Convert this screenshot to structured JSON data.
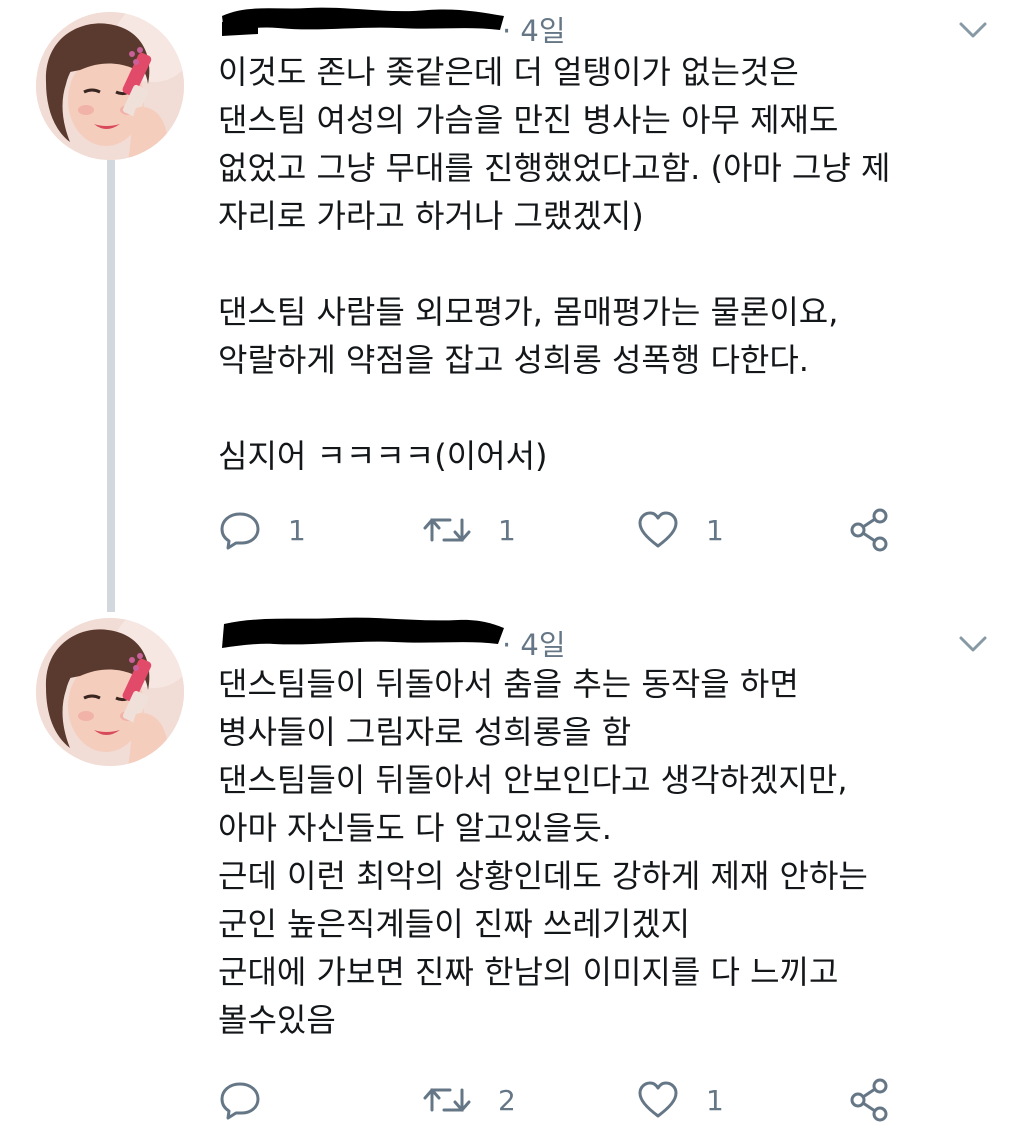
{
  "colors": {
    "text": "#14171a",
    "muted": "#657786",
    "thread_line": "#d2d8de",
    "redaction": "#000000"
  },
  "tweets": [
    {
      "time": "· 4일",
      "body": "이것도 존나 좆같은데 더 얼탱이가 없는것은\n댄스팀 여성의 가슴을 만진 병사는 아무 제재도\n없었고 그냥 무대를 진행했었다고함. (아마 그냥 제\n자리로 가라고 하거나 그랬겠지)\n\n댄스팀 사람들 외모평가, 몸매평가는 물론이요,\n악랄하게 약점을 잡고 성희롱 성폭행 다한다.\n\n심지어 ㅋㅋㅋㅋ(이어서)",
      "reply_count": "1",
      "retweet_count": "1",
      "like_count": "1"
    },
    {
      "time": "· 4일",
      "body": "댄스팀들이 뒤돌아서 춤을 추는 동작을 하면\n병사들이 그림자로 성희롱을 함\n댄스팀들이 뒤돌아서 안보인다고 생각하겠지만,\n아마 자신들도 다 알고있을듯.\n근데 이런 최악의 상황인데도 강하게 제재 안하는\n군인 높은직계들이 진짜 쓰레기겠지\n군대에 가보면 진짜 한남의 이미지를 다 느끼고\n볼수있음",
      "reply_count": "",
      "retweet_count": "2",
      "like_count": "1"
    }
  ],
  "icons": {
    "reply": "reply-icon",
    "retweet": "retweet-icon",
    "like": "heart-icon",
    "share": "share-icon",
    "menu": "chevron-down-icon"
  }
}
